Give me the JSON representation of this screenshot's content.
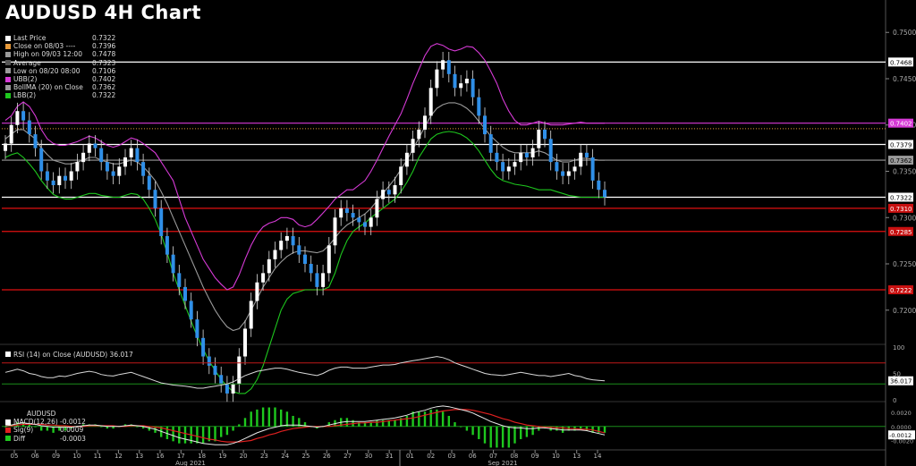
{
  "title": "AUDUSD 4H Chart",
  "legend": [
    {
      "label": "Last Price",
      "value": "0.7322",
      "color": "#ffffff"
    },
    {
      "label": "Close on 08/03 ----",
      "value": "0.7396",
      "color": "#e89a3a"
    },
    {
      "label": "High on 09/03 12:00",
      "value": "0.7478",
      "color": "#9a9a9a"
    },
    {
      "label": "Average",
      "value": "0.7323",
      "color": "#555555"
    },
    {
      "label": "Low on 08/20 08:00",
      "value": "0.7106",
      "color": "#9a9a9a"
    },
    {
      "label": "UBB(2)",
      "value": "0.7402",
      "color": "#d63ad6"
    },
    {
      "label": "BollMA (20)  on Close",
      "value": "0.7362",
      "color": "#9a9a9a"
    },
    {
      "label": "LBB(2)",
      "value": "0.7322",
      "color": "#1ec81e"
    }
  ],
  "rsi_legend": {
    "label": "RSI (14)  on Close (AUDUSD) 36.017",
    "color": "#ffffff"
  },
  "macd_legend": {
    "title": "AUDUSD",
    "rows": [
      {
        "label": "MACD(12,26)",
        "value": "-0.0012",
        "color": "#ffffff"
      },
      {
        "label": "Sig(9)",
        "value": "0.0009",
        "color": "#e02020"
      },
      {
        "label": "Diff",
        "value": "-0.0003",
        "color": "#1ec81e"
      }
    ]
  },
  "chart_data": {
    "type": "line",
    "title": "AUDUSD 4H Chart",
    "price_axis": {
      "ticks": [
        "0.7500",
        "0.7450",
        "0.7400",
        "0.7350",
        "0.7300",
        "0.7250",
        "0.7200"
      ],
      "ylim": [
        0.7165,
        0.7535
      ]
    },
    "x_ticks": [
      "05",
      "06",
      "09",
      "10",
      "11",
      "12",
      "13",
      "16",
      "17",
      "18",
      "19",
      "20",
      "23",
      "24",
      "25",
      "26",
      "27",
      "30",
      "31",
      "01",
      "02",
      "03",
      "06",
      "07",
      "08",
      "09",
      "10",
      "13",
      "14"
    ],
    "x_month_labels": [
      "Aug 2021",
      "Sep 2021"
    ],
    "horizontal_levels": [
      {
        "value": 0.7468,
        "label": "0.7468",
        "color": "#ffffff"
      },
      {
        "value": 0.7402,
        "label": "0.7402",
        "color": "#d63ad6"
      },
      {
        "value": 0.7396,
        "label": "",
        "color": "#e89a3a",
        "dotted": true
      },
      {
        "value": 0.7379,
        "label": "0.7379",
        "color": "#ffffff"
      },
      {
        "value": 0.7362,
        "label": "0.7362",
        "color": "#9a9a9a"
      },
      {
        "value": 0.7322,
        "label": "0.7322",
        "color": "#ffffff"
      },
      {
        "value": 0.731,
        "label": "0.7310",
        "color": "#e01010"
      },
      {
        "value": 0.7285,
        "label": "0.7285",
        "color": "#e01010"
      },
      {
        "value": 0.7222,
        "label": "0.7222",
        "color": "#e01010"
      }
    ],
    "close_series": [
      0.738,
      0.74,
      0.7415,
      0.7405,
      0.739,
      0.7375,
      0.735,
      0.734,
      0.7335,
      0.7345,
      0.734,
      0.735,
      0.736,
      0.737,
      0.738,
      0.7375,
      0.736,
      0.735,
      0.7345,
      0.7355,
      0.7365,
      0.7375,
      0.736,
      0.7345,
      0.733,
      0.731,
      0.728,
      0.726,
      0.724,
      0.7225,
      0.721,
      0.719,
      0.717,
      0.715,
      0.714,
      0.713,
      0.712,
      0.711,
      0.712,
      0.715,
      0.718,
      0.721,
      0.723,
      0.724,
      0.7255,
      0.7265,
      0.7275,
      0.728,
      0.727,
      0.726,
      0.725,
      0.724,
      0.7225,
      0.724,
      0.727,
      0.73,
      0.731,
      0.7305,
      0.73,
      0.7295,
      0.729,
      0.73,
      0.732,
      0.733,
      0.7325,
      0.7335,
      0.7355,
      0.737,
      0.7385,
      0.7395,
      0.741,
      0.744,
      0.746,
      0.747,
      0.7455,
      0.744,
      0.7445,
      0.745,
      0.743,
      0.741,
      0.739,
      0.737,
      0.736,
      0.735,
      0.7355,
      0.736,
      0.737,
      0.7365,
      0.7375,
      0.7395,
      0.7385,
      0.736,
      0.735,
      0.7345,
      0.735,
      0.7355,
      0.737,
      0.7365,
      0.734,
      0.733,
      0.7322
    ],
    "ubb_series": [
      0.7405,
      0.741,
      0.742,
      0.7425,
      0.742,
      0.741,
      0.7395,
      0.7385,
      0.738,
      0.7378,
      0.7378,
      0.738,
      0.7382,
      0.7385,
      0.7388,
      0.7386,
      0.7382,
      0.7378,
      0.7376,
      0.7378,
      0.7382,
      0.7386,
      0.7384,
      0.738,
      0.7375,
      0.737,
      0.736,
      0.735,
      0.734,
      0.732,
      0.73,
      0.7285,
      0.727,
      0.7255,
      0.7245,
      0.7235,
      0.7228,
      0.7222,
      0.7225,
      0.7238,
      0.7255,
      0.727,
      0.7282,
      0.729,
      0.7294,
      0.7296,
      0.73,
      0.73,
      0.7298,
      0.7292,
      0.729,
      0.7292,
      0.7298,
      0.7305,
      0.7312,
      0.732,
      0.7325,
      0.733,
      0.733,
      0.7335,
      0.734,
      0.735,
      0.7362,
      0.7375,
      0.7388,
      0.74,
      0.7412,
      0.7428,
      0.7445,
      0.746,
      0.7475,
      0.7485,
      0.7488,
      0.7486,
      0.7482,
      0.748,
      0.7482,
      0.7485,
      0.7484,
      0.7478,
      0.747,
      0.7458,
      0.7445,
      0.7428,
      0.7415,
      0.7405,
      0.74,
      0.74,
      0.7402,
      0.7404,
      0.7402,
      0.74,
      0.74,
      0.74,
      0.7401,
      0.7402,
      0.7403,
      0.7402,
      0.7402,
      0.7402,
      0.7402
    ],
    "ma_series": [
      0.7385,
      0.739,
      0.7395,
      0.7395,
      0.739,
      0.7385,
      0.7375,
      0.7368,
      0.7362,
      0.736,
      0.7358,
      0.7358,
      0.736,
      0.7362,
      0.7365,
      0.7365,
      0.7362,
      0.736,
      0.7358,
      0.7358,
      0.736,
      0.7362,
      0.736,
      0.7355,
      0.7348,
      0.734,
      0.7328,
      0.7315,
      0.73,
      0.7285,
      0.727,
      0.7255,
      0.724,
      0.7225,
      0.7212,
      0.72,
      0.719,
      0.7182,
      0.7178,
      0.718,
      0.7188,
      0.72,
      0.7212,
      0.7225,
      0.7235,
      0.7245,
      0.7252,
      0.7258,
      0.7262,
      0.7264,
      0.7264,
      0.7263,
      0.7262,
      0.7264,
      0.727,
      0.7278,
      0.7286,
      0.7292,
      0.7296,
      0.73,
      0.7304,
      0.731,
      0.7318,
      0.7326,
      0.7334,
      0.7342,
      0.7352,
      0.7362,
      0.7374,
      0.7386,
      0.7398,
      0.741,
      0.7418,
      0.7422,
      0.7424,
      0.7424,
      0.7422,
      0.7418,
      0.7412,
      0.7404,
      0.7396,
      0.7388,
      0.7382,
      0.7376,
      0.7372,
      0.737,
      0.737,
      0.737,
      0.737,
      0.7372,
      0.737,
      0.7366,
      0.7362,
      0.736,
      0.736,
      0.7362,
      0.7364,
      0.7364,
      0.7363,
      0.7362,
      0.7362
    ],
    "lbb_series": [
      0.7365,
      0.7368,
      0.737,
      0.7365,
      0.7358,
      0.735,
      0.734,
      0.7332,
      0.7325,
      0.7322,
      0.732,
      0.732,
      0.7322,
      0.7324,
      0.7326,
      0.7326,
      0.7324,
      0.7323,
      0.7322,
      0.7322,
      0.7324,
      0.7326,
      0.7325,
      0.732,
      0.731,
      0.7298,
      0.7282,
      0.7262,
      0.724,
      0.7222,
      0.7205,
      0.7188,
      0.7172,
      0.7158,
      0.7145,
      0.7135,
      0.7125,
      0.7118,
      0.7112,
      0.711,
      0.711,
      0.7115,
      0.7125,
      0.714,
      0.716,
      0.718,
      0.72,
      0.7212,
      0.7218,
      0.722,
      0.7222,
      0.7222,
      0.7222,
      0.7222,
      0.7225,
      0.724,
      0.726,
      0.7275,
      0.7285,
      0.729,
      0.7294,
      0.73,
      0.7305,
      0.731,
      0.7315,
      0.732,
      0.7328,
      0.7338,
      0.735,
      0.7365,
      0.7375,
      0.7385,
      0.739,
      0.7392,
      0.7393,
      0.7392,
      0.739,
      0.7386,
      0.738,
      0.7372,
      0.7362,
      0.7352,
      0.7344,
      0.734,
      0.7338,
      0.7336,
      0.7335,
      0.7334,
      0.7332,
      0.733,
      0.733,
      0.733,
      0.7328,
      0.7326,
      0.7324,
      0.7323,
      0.7322,
      0.7322,
      0.7322,
      0.7322,
      0.7322
    ],
    "rsi": {
      "last": "36.017",
      "levels": [
        70,
        30
      ],
      "ticks": [
        "100",
        "50",
        "0"
      ],
      "values": [
        52,
        55,
        58,
        55,
        50,
        48,
        44,
        42,
        42,
        45,
        44,
        47,
        50,
        52,
        54,
        52,
        48,
        46,
        45,
        48,
        50,
        52,
        48,
        44,
        40,
        36,
        32,
        30,
        28,
        27,
        26,
        24,
        22,
        22,
        24,
        26,
        28,
        30,
        34,
        40,
        46,
        50,
        54,
        56,
        58,
        60,
        60,
        58,
        55,
        52,
        50,
        48,
        46,
        50,
        56,
        60,
        62,
        62,
        60,
        60,
        60,
        62,
        64,
        66,
        66,
        67,
        70,
        72,
        74,
        76,
        78,
        80,
        82,
        80,
        76,
        70,
        66,
        62,
        58,
        54,
        50,
        48,
        47,
        46,
        48,
        50,
        52,
        50,
        48,
        46,
        46,
        44,
        46,
        48,
        50,
        46,
        44,
        40,
        38,
        37,
        36
      ]
    },
    "macd": {
      "last": "-0.0012",
      "ticks": [
        "0.0020",
        "0.0000",
        "-0.0020"
      ],
      "macd": [
        0.0001,
        0.0002,
        0.0004,
        0.0005,
        0.0004,
        0.0003,
        0.0001,
        0.0,
        -0.0001,
        -0.0001,
        -0.0001,
        -0.0001,
        0.0,
        0.0001,
        0.0002,
        0.0002,
        0.0001,
        0.0,
        0.0,
        0.0,
        0.0001,
        0.0002,
        0.0001,
        0.0,
        -0.0002,
        -0.0004,
        -0.0007,
        -0.001,
        -0.0013,
        -0.0016,
        -0.0018,
        -0.002,
        -0.0022,
        -0.0024,
        -0.0025,
        -0.0026,
        -0.0026,
        -0.0026,
        -0.0024,
        -0.0021,
        -0.0017,
        -0.0013,
        -0.0009,
        -0.0006,
        -0.0003,
        -0.0001,
        0.0001,
        0.0002,
        0.0002,
        0.0002,
        0.0001,
        0.0,
        -0.0001,
        0.0,
        0.0002,
        0.0004,
        0.0006,
        0.0007,
        0.0007,
        0.0007,
        0.0007,
        0.0008,
        0.0009,
        0.001,
        0.0011,
        0.0012,
        0.0014,
        0.0016,
        0.0019,
        0.0021,
        0.0023,
        0.0026,
        0.0028,
        0.0029,
        0.0028,
        0.0026,
        0.0024,
        0.0022,
        0.0019,
        0.0015,
        0.0011,
        0.0007,
        0.0004,
        0.0001,
        -0.0001,
        -0.0002,
        -0.0002,
        -0.0003,
        -0.0003,
        -0.0002,
        -0.0002,
        -0.0003,
        -0.0004,
        -0.0005,
        -0.0005,
        -0.0005,
        -0.0005,
        -0.0006,
        -0.0008,
        -0.001,
        -0.0012
      ],
      "signal": [
        0.0001,
        0.0001,
        0.0002,
        0.0003,
        0.0003,
        0.0003,
        0.0003,
        0.0002,
        0.0002,
        0.0001,
        0.0001,
        0.0,
        0.0,
        0.0,
        0.0001,
        0.0001,
        0.0001,
        0.0001,
        0.0001,
        0.0,
        0.0,
        0.0001,
        0.0001,
        0.0001,
        0.0,
        -0.0001,
        -0.0002,
        -0.0004,
        -0.0006,
        -0.0008,
        -0.001,
        -0.0012,
        -0.0014,
        -0.0016,
        -0.0018,
        -0.0019,
        -0.0021,
        -0.0022,
        -0.0022,
        -0.0022,
        -0.0021,
        -0.002,
        -0.0017,
        -0.0015,
        -0.0012,
        -0.001,
        -0.0007,
        -0.0005,
        -0.0003,
        -0.0002,
        -0.0001,
        0.0,
        0.0,
        0.0,
        0.0,
        0.0001,
        0.0002,
        0.0003,
        0.0004,
        0.0005,
        0.0005,
        0.0006,
        0.0006,
        0.0007,
        0.0008,
        0.0009,
        0.001,
        0.0011,
        0.0012,
        0.0014,
        0.0016,
        0.0018,
        0.002,
        0.0022,
        0.0023,
        0.0024,
        0.0024,
        0.0024,
        0.0023,
        0.0021,
        0.0019,
        0.0017,
        0.0014,
        0.0011,
        0.0009,
        0.0006,
        0.0004,
        0.0002,
        0.0001,
        0.0,
        -0.0001,
        -0.0001,
        -0.0002,
        -0.0002,
        -0.0003,
        -0.0003,
        -0.0004,
        -0.0004,
        -0.0005,
        -0.0007,
        -0.0009
      ]
    }
  }
}
